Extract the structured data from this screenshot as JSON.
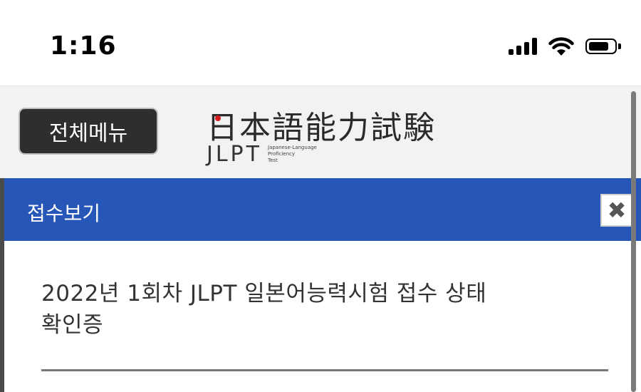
{
  "status_bar": {
    "time": "1:16",
    "icons": [
      "cellular-signal-icon",
      "wifi-icon",
      "battery-icon"
    ]
  },
  "header": {
    "menu_button_label": "전체메뉴",
    "logo": {
      "title": "日本語能力試験",
      "abbr": "JLPT",
      "sub_lines": [
        "Japanese-Language",
        "Proficiency",
        "Test"
      ]
    }
  },
  "modal": {
    "title": "접수보기",
    "close_icon": "close-icon",
    "heading_line1": "2022년 1회차 JLPT 일본어능력시험 접수 상태",
    "heading_line2": "확인증"
  },
  "colors": {
    "modal_header": "#2556b8",
    "menu_button": "#2e2e2e",
    "header_bg": "#f2f2f2",
    "logo_dot": "#d51a1a"
  }
}
